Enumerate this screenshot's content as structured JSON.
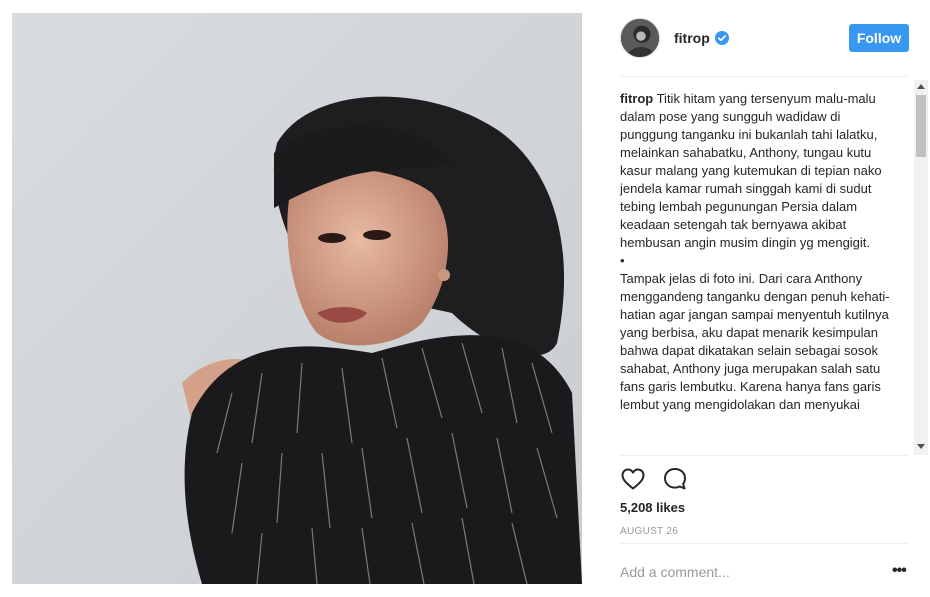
{
  "post": {
    "username": "fitrop",
    "follow_label": "Follow",
    "caption_user": "fitrop",
    "caption_text": " Titik hitam yang tersenyum malu-malu dalam pose yang sungguh wadidaw di punggung tanganku ini bukanlah tahi lalatku, melainkan sahabatku, Anthony, tungau kutu kasur malang yang kutemukan di tepian nako jendela kamar rumah singgah kami di sudut tebing lembah pegunungan Persia dalam keadaan setengah tak bernyawa akibat hembusan angin musim dingin yg mengigit.\n•\nTampak jelas di foto ini. Dari cara Anthony menggandeng tanganku dengan penuh kehati-hatian agar jangan sampai menyentuh kutilnya yang berbisa, aku dapat menarik kesimpulan bahwa dapat dikatakan selain sebagai sosok sahabat, Anthony juga merupakan salah satu fans garis lembutku. Karena hanya fans garis lembut yang mengidolakan dan menyukai",
    "likes": "5,208 likes",
    "date": "AUGUST 26",
    "comment_placeholder": "Add a comment...",
    "more_label": "•••"
  },
  "icons": {
    "verified": "verified-badge-icon",
    "like": "heart-icon",
    "comment": "comment-bubble-icon",
    "more": "more-options-icon"
  },
  "colors": {
    "accent": "#3897f0",
    "muted": "#999999",
    "text": "#262626"
  }
}
